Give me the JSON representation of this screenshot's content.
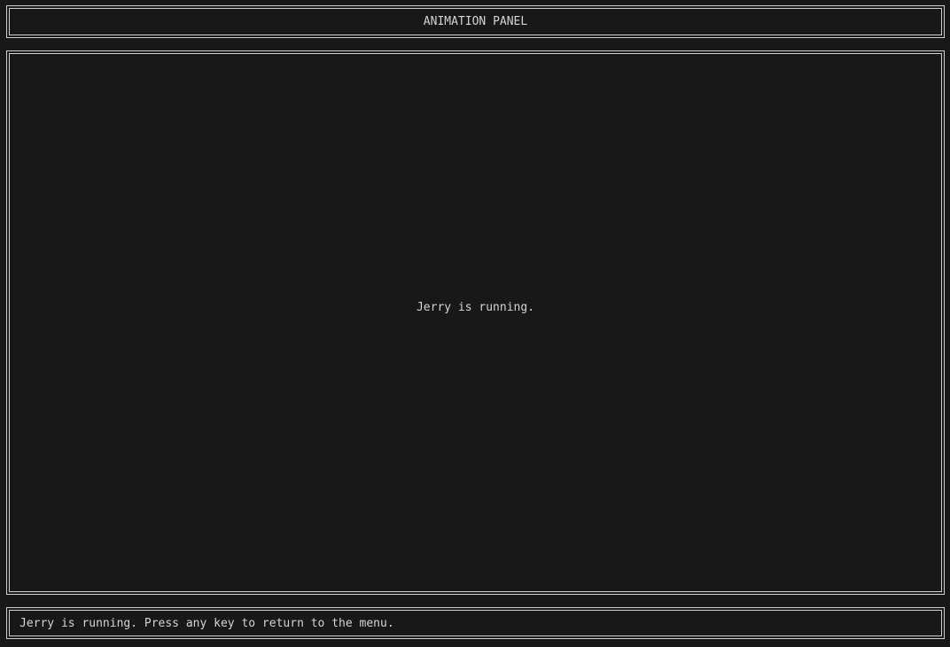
{
  "header": {
    "title": "ANIMATION PANEL"
  },
  "main": {
    "message": "Jerry is running."
  },
  "status_bar": {
    "text": "Jerry is running. Press any key to return to the menu."
  }
}
